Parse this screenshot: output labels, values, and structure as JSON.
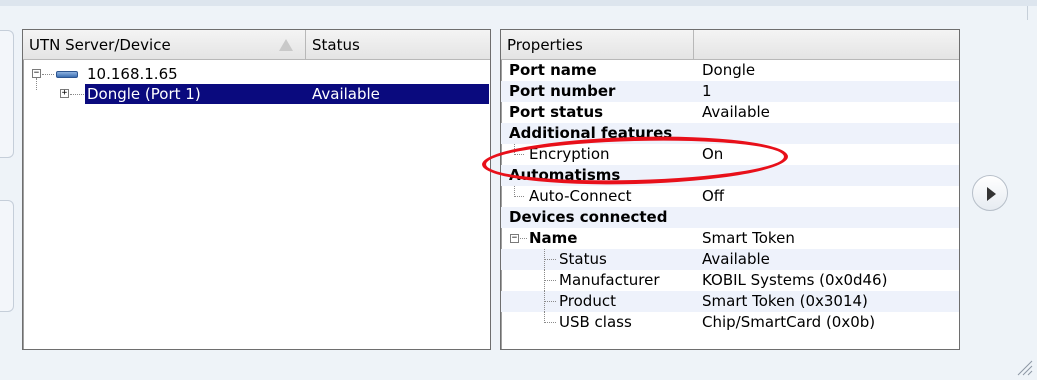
{
  "left_panel": {
    "columns": [
      "UTN Server/Device",
      "Status"
    ],
    "server": {
      "address": "10.168.1.65"
    },
    "device": {
      "name": "Dongle (Port 1)",
      "status": "Available"
    }
  },
  "right_panel": {
    "columns": [
      "Properties",
      ""
    ],
    "rows": [
      {
        "key": "Port name",
        "value": "Dongle"
      },
      {
        "key": "Port number",
        "value": "1"
      },
      {
        "key": "Port status",
        "value": "Available"
      },
      {
        "key": "Additional features",
        "value": ""
      },
      {
        "key": "Encryption",
        "value": "On"
      },
      {
        "key": "Automatisms",
        "value": ""
      },
      {
        "key": "Auto-Connect",
        "value": "Off"
      },
      {
        "key": "Devices connected",
        "value": ""
      },
      {
        "key": "Name",
        "value": "Smart Token"
      },
      {
        "key": "Status",
        "value": "Available"
      },
      {
        "key": "Manufacturer",
        "value": "KOBIL Systems (0x0d46)"
      },
      {
        "key": "Product",
        "value": "Smart Token (0x3014)"
      },
      {
        "key": "USB class",
        "value": "Chip/SmartCard (0x0b)"
      }
    ]
  },
  "icons": {
    "sort": "sort-ascending-icon",
    "server": "server-icon",
    "next": "chevron-right-icon",
    "resize": "resize-grip-icon"
  },
  "colors": {
    "selection": "#0a0a7e",
    "annotation": "#e8101a",
    "background": "#eef3f8"
  }
}
